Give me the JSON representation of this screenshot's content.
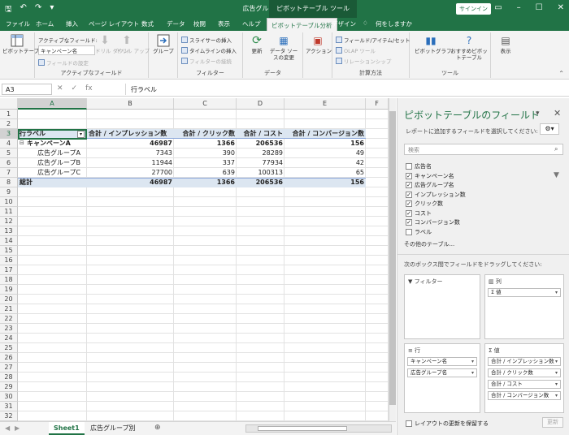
{
  "window": {
    "title": "広告グループ別.xlsx - Excel",
    "context_tool": "ピボットテーブル ツール",
    "signin": "サインイン",
    "qat": [
      "保存",
      "元に戻す",
      "やり直し"
    ]
  },
  "tabs": [
    "ファイル",
    "ホーム",
    "挿入",
    "ページ レイアウト",
    "数式",
    "データ",
    "校閲",
    "表示",
    "ヘルプ",
    "ピボットテーブル分析",
    "デザイン",
    "何をしますか"
  ],
  "ribbon": {
    "pivot": {
      "btn": "ピボットテーブル"
    },
    "active_field": {
      "label": "アクティブなフィールド:",
      "value": "キャンペーン名",
      "settings": "フィールドの設定",
      "drill_down": "ドリル ダウン",
      "drill_up": "ドリル アップ",
      "group_label": "アクティブなフィールド"
    },
    "group": {
      "btn": "グループ"
    },
    "filter": {
      "slicer": "スライサーの挿入",
      "timeline": "タイムラインの挿入",
      "conn": "フィルターの接続",
      "group_label": "フィルター"
    },
    "data": {
      "refresh": "更新",
      "source": "データ ソースの変更",
      "group_label": "データ"
    },
    "action": {
      "btn": "アクション"
    },
    "calc": {
      "fields": "フィールド/アイテム/セット",
      "olap": "OLAP ツール",
      "rel": "リレーションシップ",
      "group_label": "計算方法"
    },
    "tools": {
      "chart": "ピボットグラフ",
      "recommended": "おすすめピボットテーブル",
      "group_label": "ツール"
    },
    "show": {
      "btn": "表示"
    }
  },
  "formula": {
    "namebox": "A3",
    "value": "行ラベル",
    "fx": "fx"
  },
  "columns": [
    "A",
    "B",
    "C",
    "D",
    "E",
    "F"
  ],
  "rows": [
    "1",
    "2",
    "3",
    "4",
    "5",
    "6",
    "7",
    "8",
    "9",
    "10",
    "11",
    "12",
    "13",
    "14",
    "15",
    "16",
    "17",
    "18",
    "19",
    "20",
    "21",
    "22",
    "23",
    "24",
    "25",
    "26",
    "27",
    "28",
    "29",
    "30",
    "31",
    "32"
  ],
  "pivot": {
    "headers": [
      "行ラベル",
      "合計 / インプレッション数",
      "合計 / クリック数",
      "合計 / コスト",
      "合計 / コンバージョン数"
    ],
    "rows": [
      {
        "label": "キャンペーンA",
        "values": [
          "46987",
          "1366",
          "206536",
          "156"
        ]
      },
      {
        "label": "広告グループA",
        "values": [
          "7343",
          "390",
          "28289",
          "49"
        ]
      },
      {
        "label": "広告グループB",
        "values": [
          "11944",
          "337",
          "77934",
          "42"
        ]
      },
      {
        "label": "広告グループC",
        "values": [
          "27700",
          "639",
          "100313",
          "65"
        ]
      },
      {
        "label": "総計",
        "values": [
          "46987",
          "1366",
          "206536",
          "156"
        ]
      }
    ]
  },
  "sheet_tabs": [
    "Sheet1",
    "広告グループ別"
  ],
  "pane": {
    "title": "ピボットテーブルのフィールド",
    "subtitle": "レポートに追加するフィールドを選択してください:",
    "search_placeholder": "検索",
    "fields": [
      {
        "name": "広告名",
        "checked": false
      },
      {
        "name": "キャンペーン名",
        "checked": true
      },
      {
        "name": "広告グループ名",
        "checked": true
      },
      {
        "name": "インプレッション数",
        "checked": true
      },
      {
        "name": "クリック数",
        "checked": true
      },
      {
        "name": "コスト",
        "checked": true
      },
      {
        "name": "コンバージョン数",
        "checked": true
      },
      {
        "name": "ラベル",
        "checked": false
      }
    ],
    "more_tables": "その他のテーブル...",
    "drag_hint": "次のボックス間でフィールドをドラッグしてください:",
    "areas": {
      "filters": "フィルター",
      "columns": "列",
      "rows": "行",
      "values": "値"
    },
    "columns_items": [
      "Σ 値"
    ],
    "rows_items": [
      "キャンペーン名",
      "広告グループ名"
    ],
    "values_items": [
      "合計 / インプレッション数",
      "合計 / クリック数",
      "合計 / コスト",
      "合計 / コンバージョン数"
    ],
    "defer": "レイアウトの更新を保留する",
    "update": "更新"
  }
}
